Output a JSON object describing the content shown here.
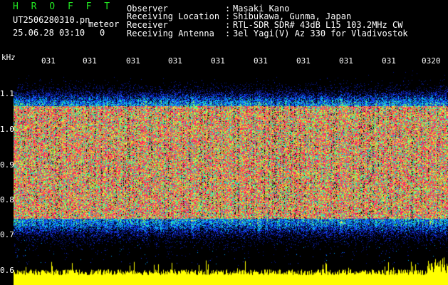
{
  "header": {
    "brand": "H R O F F T",
    "file_name": "UT2506280310.pn",
    "mode_tag": "meteor",
    "datetime": "25.06.28 03:10",
    "counter": "0"
  },
  "station_info": [
    {
      "label": "Observer",
      "value": "Masaki Kano"
    },
    {
      "label": "Receiving Location",
      "value": "Shibukawa, Gunma, Japan"
    },
    {
      "label": "Receiver",
      "value": "RTL-SDR SDR# 43dB L15 103.2MHz CW"
    },
    {
      "label": "Receiving Antenna",
      "value": "3el Yagi(V) Az 330 for Vladivostok"
    }
  ],
  "separator": ":",
  "y_axis": {
    "unit": "kHz",
    "ticks": [
      "1.1",
      "1.0",
      "0.9",
      "0.8",
      "0.7",
      "0.6"
    ]
  },
  "x_axis": {
    "ticks": [
      "031",
      "031",
      "031",
      "031",
      "031",
      "031",
      "031",
      "031",
      "031",
      "0320"
    ]
  },
  "colors": {
    "background": "#000000",
    "text": "#ffffff",
    "brand": "#22e622",
    "noise_low": "#0a1a9a",
    "noise_mid": "#00a8ff",
    "noise_high": "#ff1a6e",
    "power_trace": "#ffff00"
  }
}
